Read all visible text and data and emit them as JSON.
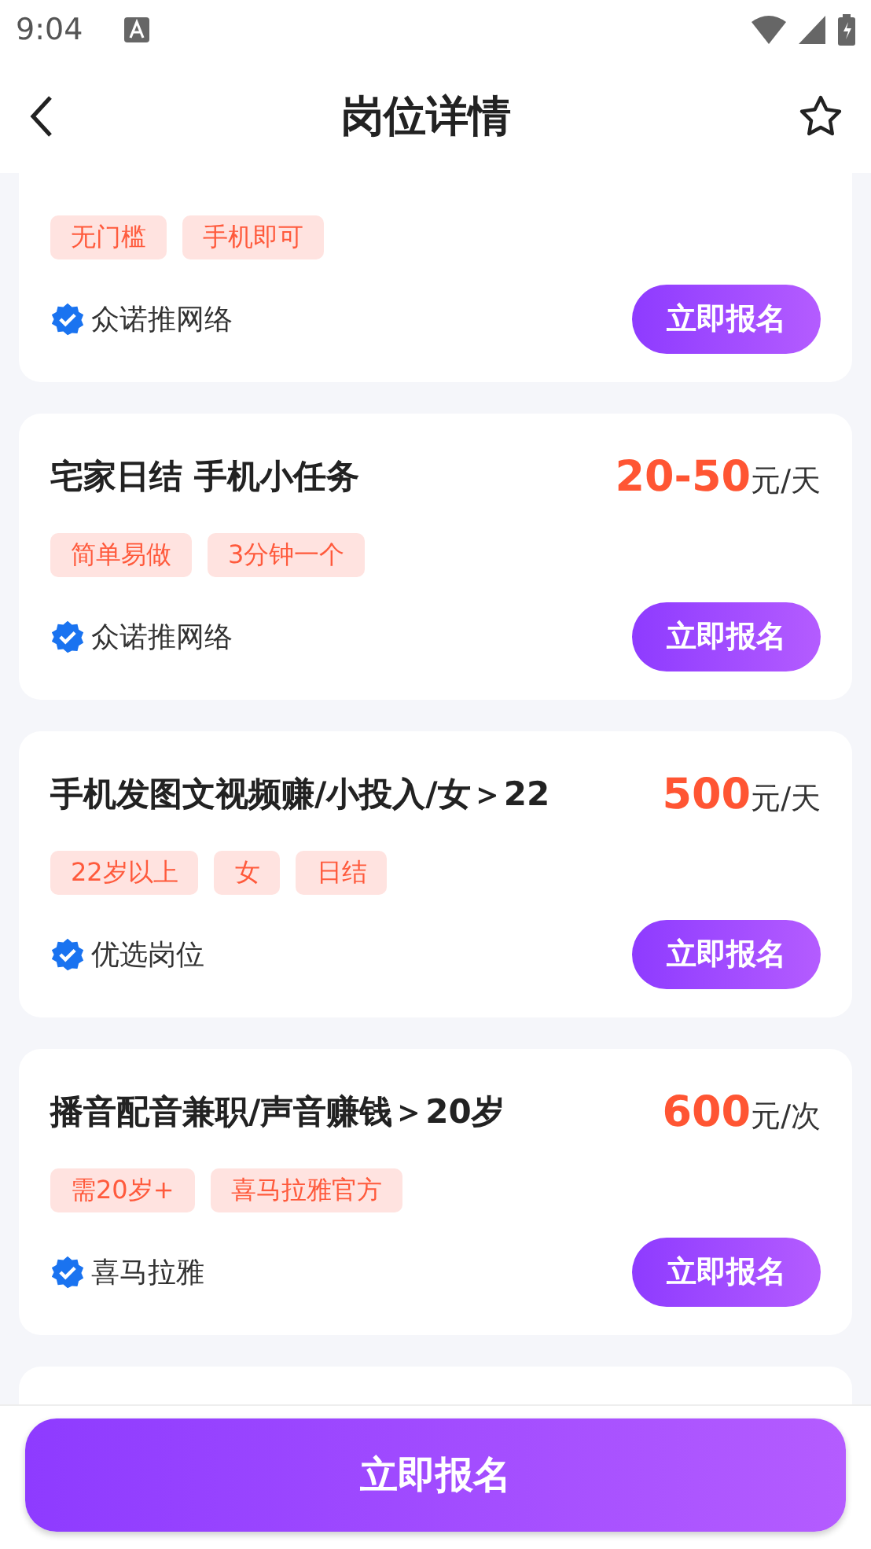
{
  "status_bar": {
    "time": "9:04"
  },
  "header": {
    "title": "岗位详情"
  },
  "jobs": [
    {
      "kind": "clipped-top",
      "tags": [
        "无门槛",
        "手机即可"
      ],
      "company": "众诺推网络",
      "button": "立即报名"
    },
    {
      "kind": "full",
      "title": "宅家日结 手机小任务",
      "price": "20-50",
      "unit": "元/天",
      "tags": [
        "简单易做",
        "3分钟一个"
      ],
      "company": "众诺推网络",
      "button": "立即报名"
    },
    {
      "kind": "full",
      "title": "手机发图文视频赚/小投入/女＞22",
      "price": "500",
      "unit": "元/天",
      "tags": [
        "22岁以上",
        "女",
        "日结"
      ],
      "company": "优选岗位",
      "button": "立即报名"
    },
    {
      "kind": "full",
      "title": "播音配音兼职/声音赚钱＞20岁",
      "price": "600",
      "unit": "元/次",
      "tags": [
        "需20岁+",
        "喜马拉雅官方"
      ],
      "company": "喜马拉雅",
      "button": "立即报名"
    },
    {
      "kind": "clipped-bottom"
    }
  ],
  "bottom_button": {
    "label": "立即报名"
  }
}
